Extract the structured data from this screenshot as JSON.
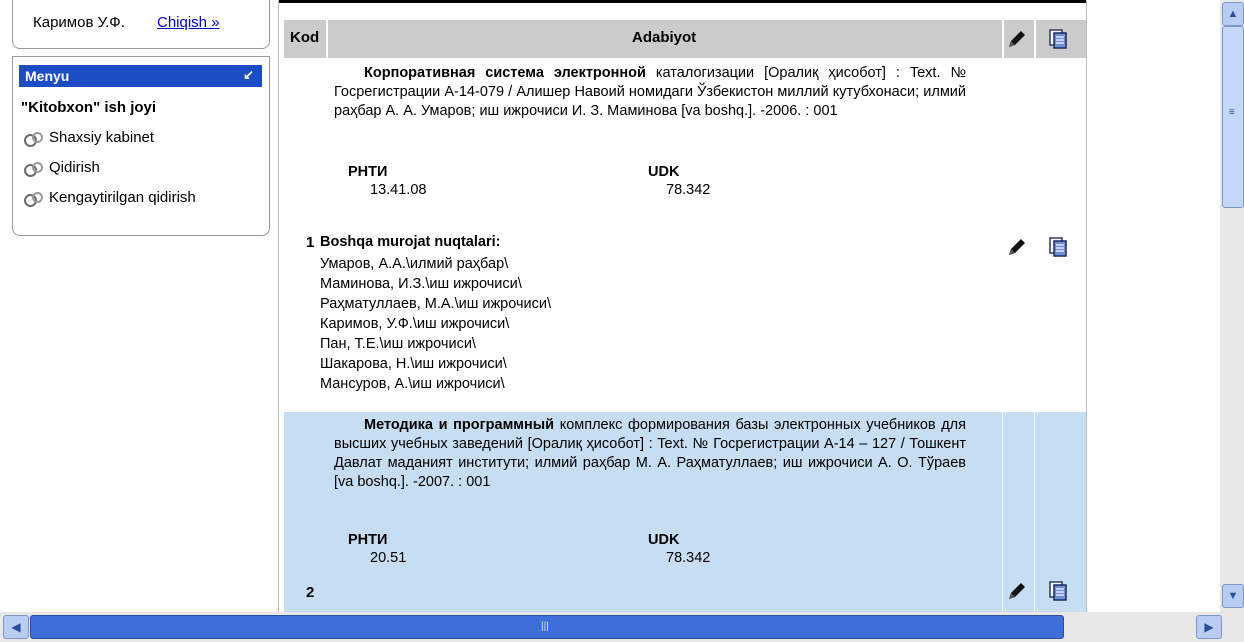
{
  "user": {
    "name": "Каримов У.Ф.",
    "exit_label": "Chiqish »"
  },
  "menu": {
    "header": "Menyu",
    "header_arrow": "↙",
    "section": "\"Kitobxon\" ish joyi",
    "items": [
      {
        "label": "Shaxsiy kabinet",
        "icon": "search-binoculars-icon"
      },
      {
        "label": "Qidirish",
        "icon": "search-binoculars-icon"
      },
      {
        "label": "Kengaytirilgan qidirish",
        "icon": "search-binoculars-icon"
      }
    ]
  },
  "table": {
    "headers": {
      "kod": "Kod",
      "adabiyot": "Adabiyot"
    },
    "rows": [
      {
        "num": "1",
        "lead": "Корпоративная система электронной",
        "rest": " каталогизации [Оралиқ ҳисобот] : Text. № Госрегистрации А-14-079 / Алишер Навоий номидаги Ўзбекистон миллий кутубхонаси; илмий раҳбар А. А. Умаров; иш ижрочиси И. З. Маминова [va boshq.]. -2006. : 001",
        "rnti_label": "РНТИ",
        "rnti": "13.41.08",
        "udk_label": "UDK",
        "udk": "78.342",
        "other_title": "Boshqa murojat nuqtalari:",
        "others": [
          "Умаров, А.А.\\илмий раҳбар\\",
          "Маминова, И.З.\\иш ижрочиси\\",
          "Раҳматуллаев, М.А.\\иш ижрочиси\\",
          "Каримов, У.Ф.\\иш ижрочиси\\",
          "Пан, Т.Е.\\иш ижрочиси\\",
          "Шакарова, Н.\\иш ижрочиси\\",
          "Мансуров, А.\\иш ижрочиси\\"
        ]
      },
      {
        "num": "2",
        "lead": "Методика и программный",
        "rest": " комплекс формирования базы электронных учебников для высших учебных заведений [Оралиқ ҳисобот] : Text. № Госрегистрации А-14 – 127 / Тошкент Давлат маданият институти; илмий раҳбар М. А. Раҳматуллаев; иш ижрочиси А. О. Тўраев [va boshq.]. -2007. : 001",
        "rnti_label": "РНТИ",
        "rnti": "20.51",
        "udk_label": "UDK",
        "udk": "78.342"
      }
    ]
  },
  "colors": {
    "menu_header": "#1c4cc4",
    "row_highlight": "#c6ddf2",
    "table_header": "#cbcbcb",
    "scroll_thumb": "#3d6ed9"
  }
}
